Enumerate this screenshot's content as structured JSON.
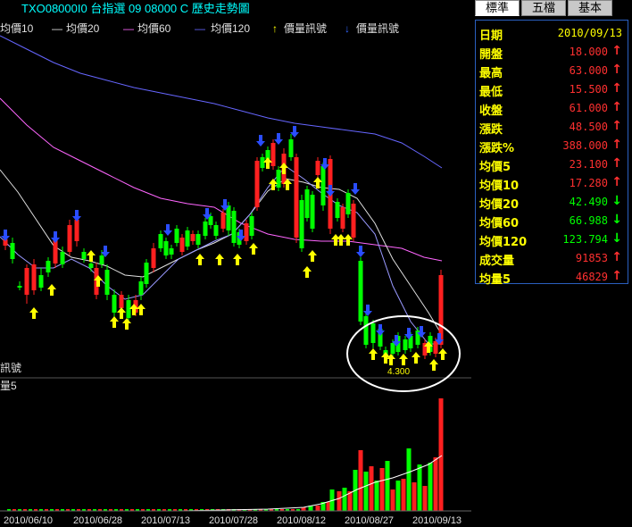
{
  "title": "TXO08000I0 台指選 09 08000 C  歷史走勢圖",
  "legend": [
    {
      "label": "均價10",
      "color": "#e0e0e0"
    },
    {
      "label": "均價20",
      "color": "#e0e0e0"
    },
    {
      "label": "均價60",
      "color": "#ff66ff"
    },
    {
      "label": "均價120",
      "color": "#6666ff"
    },
    {
      "label": "價量訊號",
      "color": "#ffff00"
    },
    {
      "label": "價量訊號",
      "color": "#3366ff"
    }
  ],
  "signal_label": "訊號",
  "volume_label": "量5",
  "annotation": "4.300",
  "x_axis_labels": [
    "2010/06/10",
    "2010/06/28",
    "2010/07/13",
    "2010/07/28",
    "2010/08/12",
    "2010/08/27",
    "2010/09/13"
  ],
  "tabs": [
    "標準",
    "五檔",
    "基本"
  ],
  "info_rows": [
    {
      "label": "日期",
      "value": "2010/09/13",
      "color": "yellow",
      "arrow": ""
    },
    {
      "label": "開盤",
      "value": "18.000",
      "color": "red",
      "arrow": "↑"
    },
    {
      "label": "最高",
      "value": "63.000",
      "color": "red",
      "arrow": "↑"
    },
    {
      "label": "最低",
      "value": "15.500",
      "color": "red",
      "arrow": "↑"
    },
    {
      "label": "收盤",
      "value": "61.000",
      "color": "red",
      "arrow": "↑"
    },
    {
      "label": "漲跌",
      "value": "48.500",
      "color": "red",
      "arrow": "↑"
    },
    {
      "label": "漲跌%",
      "value": "388.000",
      "color": "red",
      "arrow": "↑"
    },
    {
      "label": "均價5",
      "value": "23.100",
      "color": "red",
      "arrow": "↑"
    },
    {
      "label": "均價10",
      "value": "17.280",
      "color": "red",
      "arrow": "↑"
    },
    {
      "label": "均價20",
      "value": "42.490",
      "color": "green",
      "arrow": "↓"
    },
    {
      "label": "均價60",
      "value": "66.988",
      "color": "green",
      "arrow": "↓"
    },
    {
      "label": "均價120",
      "value": "123.794",
      "color": "green",
      "arrow": "↓"
    },
    {
      "label": "成交量",
      "value": "91853",
      "color": "red",
      "arrow": "↑"
    },
    {
      "label": "均量5",
      "value": "46829",
      "color": "red",
      "arrow": "↑"
    }
  ],
  "colors": {
    "up": "#ff2020",
    "down": "#00ff00",
    "bg": "#000000",
    "title": "#00ffff",
    "frame": "#2a5fbf",
    "volume_ma": "#ffffff"
  }
}
